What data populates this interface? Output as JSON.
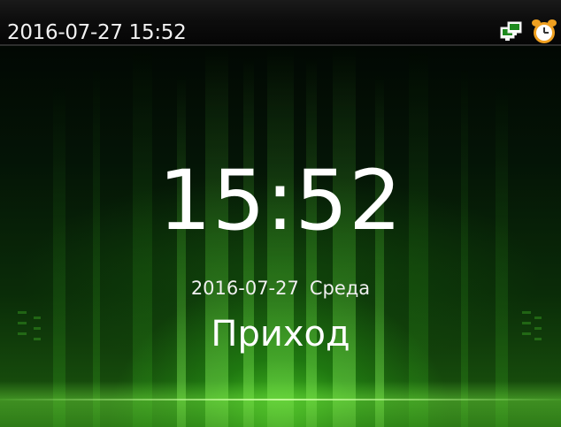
{
  "status_bar": {
    "datetime": "2016-07-27 15:52",
    "icons": [
      "network-icon",
      "alarm-clock-icon"
    ]
  },
  "main": {
    "time": "15:52",
    "date": "2016-07-27",
    "weekday": "Среда",
    "state": "Приход"
  },
  "colors": {
    "background_glow": "#3cc81e",
    "text": "#ffffff",
    "alarm_icon": "#f0a020"
  }
}
